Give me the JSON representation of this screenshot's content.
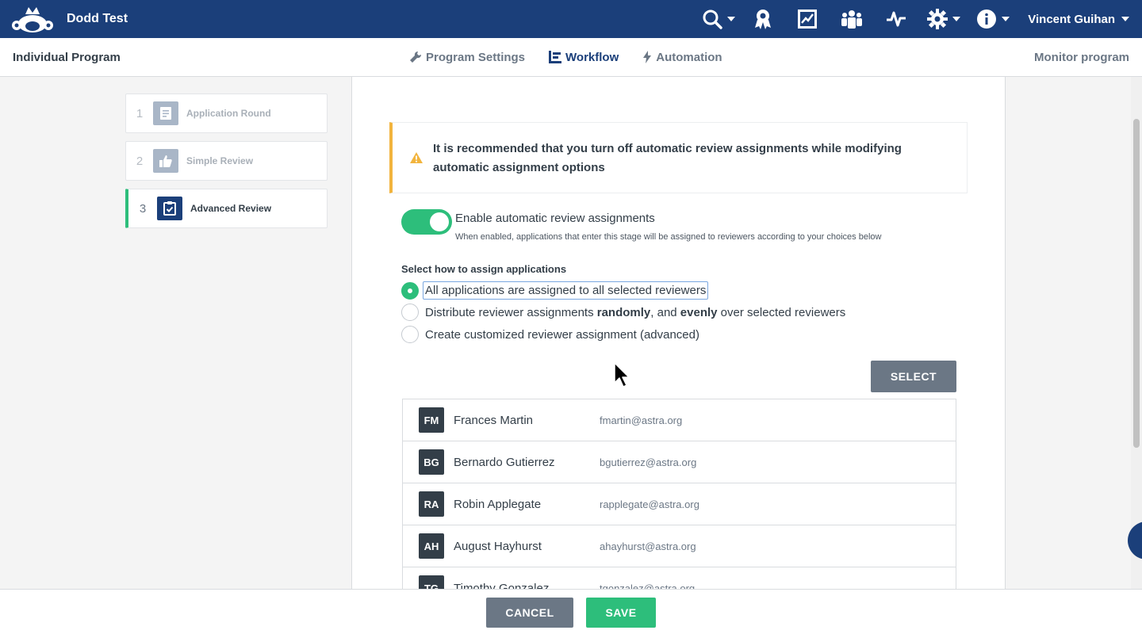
{
  "header": {
    "app_title": "Dodd Test",
    "user_name": "Vincent Guihan",
    "icons": [
      "search-icon",
      "award-icon",
      "chart-icon",
      "users-icon",
      "activity-icon",
      "gear-icon",
      "info-icon"
    ]
  },
  "subnav": {
    "program_title": "Individual Program",
    "tabs": [
      {
        "label": "Program Settings",
        "icon": "wrench-icon"
      },
      {
        "label": "Workflow",
        "icon": "workflow-icon",
        "active": true
      },
      {
        "label": "Automation",
        "icon": "bolt-icon"
      }
    ],
    "monitor_label": "Monitor program"
  },
  "stages": [
    {
      "num": "1",
      "label": "Application Round",
      "icon": "document-icon"
    },
    {
      "num": "2",
      "label": "Simple Review",
      "icon": "thumbs-up-icon"
    },
    {
      "num": "3",
      "label": "Advanced Review",
      "icon": "clipboard-check-icon",
      "active": true
    }
  ],
  "alert": {
    "text": "It is recommended that you turn off automatic review assignments while modifying automatic assignment options"
  },
  "auto_assign": {
    "enabled": true,
    "label": "Enable automatic review assignments",
    "help": "When enabled, applications that enter this stage will be assigned to reviewers according to your choices below"
  },
  "assign_method": {
    "title": "Select how to assign applications",
    "options": [
      {
        "label": "All applications are assigned to all selected reviewers",
        "checked": true
      },
      {
        "pre": "Distribute reviewer assignments ",
        "bold1": "randomly",
        "mid": ", and ",
        "bold2": "evenly",
        "post": " over selected reviewers"
      },
      {
        "label": "Create customized reviewer assignment (advanced)"
      }
    ]
  },
  "select_label": "SELECT",
  "reviewers": [
    {
      "initials": "FM",
      "name": "Frances Martin",
      "email": "fmartin@astra.org"
    },
    {
      "initials": "BG",
      "name": "Bernardo Gutierrez",
      "email": "bgutierrez@astra.org"
    },
    {
      "initials": "RA",
      "name": "Robin Applegate",
      "email": "rapplegate@astra.org"
    },
    {
      "initials": "AH",
      "name": "August Hayhurst",
      "email": "ahayhurst@astra.org"
    },
    {
      "initials": "TG",
      "name": "Timothy Gonzalez",
      "email": "tgonzalez@astra.org"
    }
  ],
  "footer": {
    "cancel_label": "CANCEL",
    "save_label": "SAVE"
  },
  "colors": {
    "brand": "#1b3f7a",
    "accent": "#2dbe7b",
    "warning": "#f2b43d",
    "neutral_button": "#6b7785"
  }
}
